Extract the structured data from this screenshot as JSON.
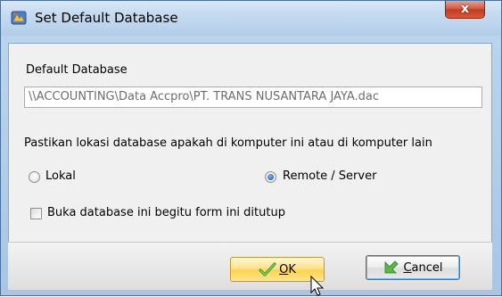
{
  "window": {
    "title": "Set Default Database",
    "close_label": "x"
  },
  "form": {
    "db_label": "Default Database",
    "db_path": "\\\\ACCOUNTING\\Data Accpro\\PT. TRANS NUSANTARA JAYA.dac",
    "location_prompt": "Pastikan lokasi database apakah di komputer ini atau di komputer lain",
    "radio_local": "Lokal",
    "radio_remote": "Remote / Server",
    "selected_location": "Remote / Server",
    "checkbox_label": "Buka database ini begitu form ini ditutup",
    "checkbox_checked": false
  },
  "buttons": {
    "ok_accel": "O",
    "ok_rest": "K",
    "cancel_accel": "C",
    "cancel_rest": "ancel"
  }
}
